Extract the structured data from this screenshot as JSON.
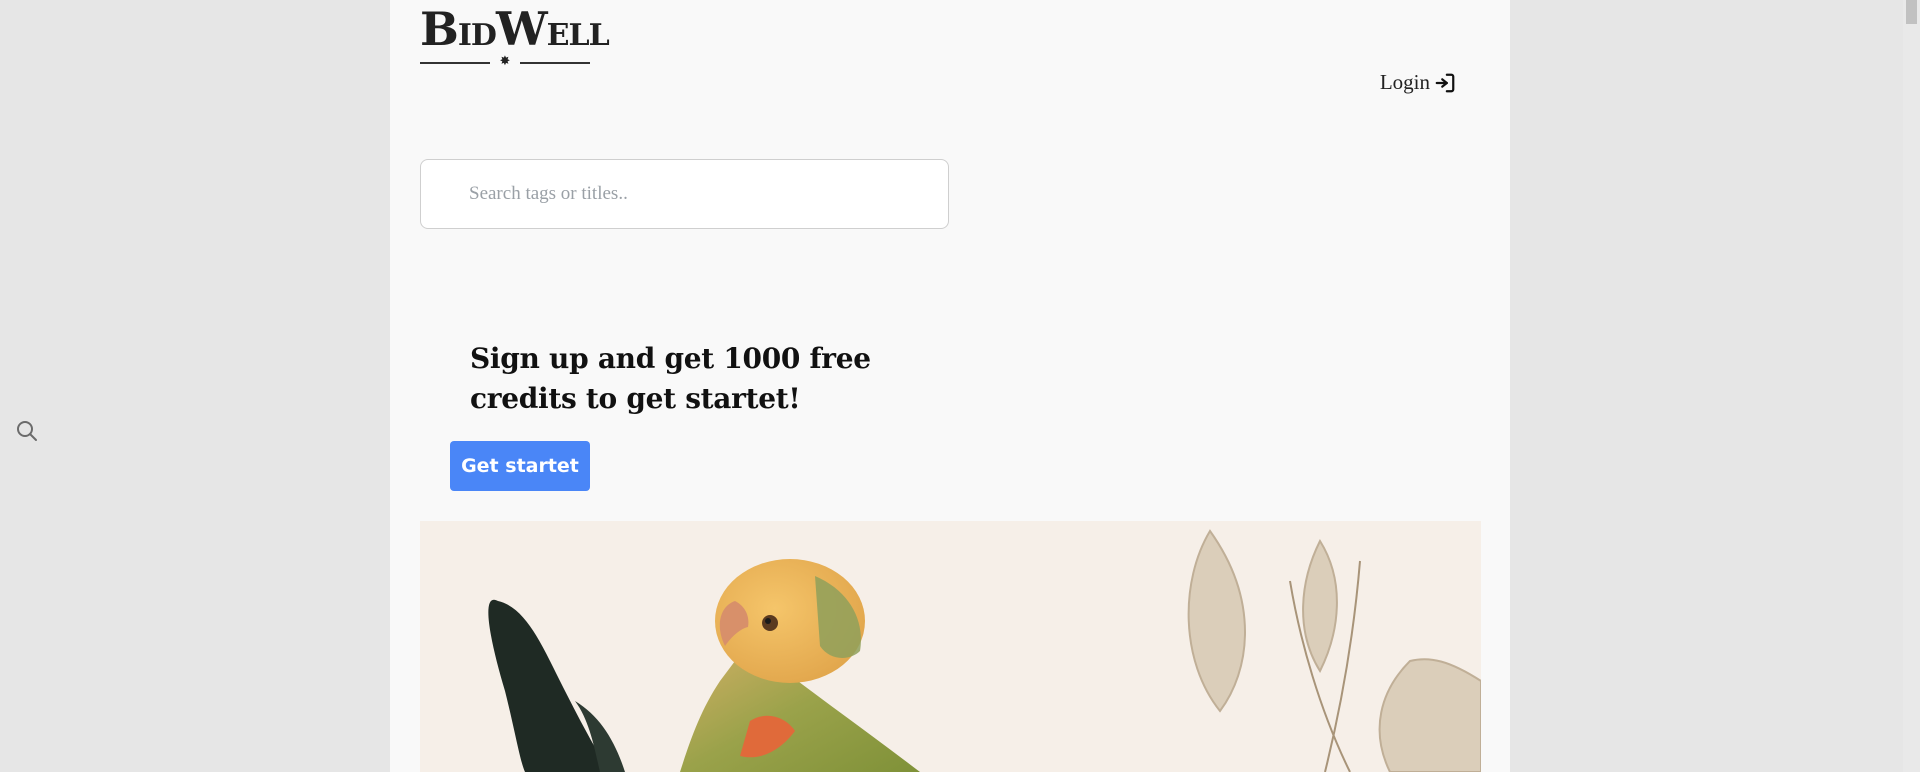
{
  "brand": {
    "logo_text_b": "B",
    "logo_text_id": "ID",
    "logo_text_w": "W",
    "logo_text_ell": "ELL",
    "logo_ornament": "✸"
  },
  "header": {
    "login_label": "Login",
    "login_icon": "sign-in-icon"
  },
  "search": {
    "placeholder": "Search tags or titles..",
    "value": ""
  },
  "sidebar": {
    "search_icon": "search-icon"
  },
  "promo": {
    "headline": "Sign up and get 1000 free credits to get startet!",
    "cta_label": "Get startet"
  },
  "colors": {
    "accent": "#4a86f7",
    "page_background": "#e6e6e6",
    "content_background": "#f9f9f9",
    "text": "#111111"
  }
}
